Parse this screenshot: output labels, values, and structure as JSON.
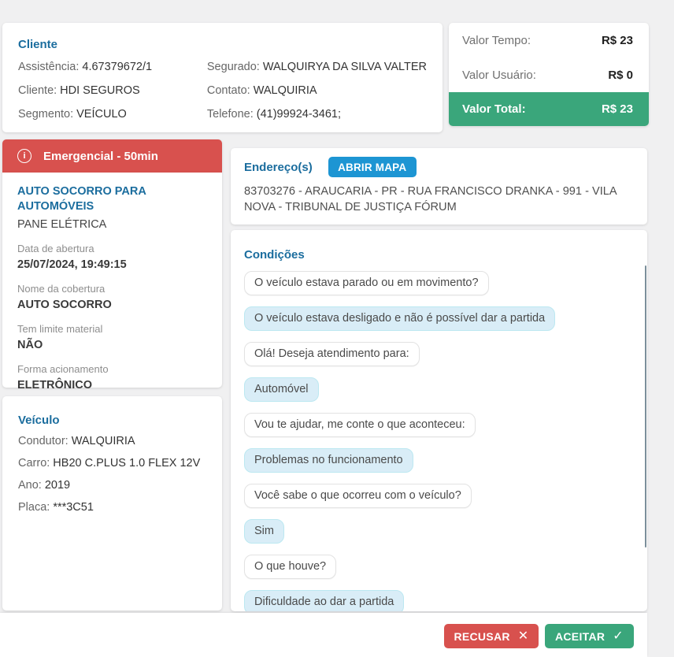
{
  "cliente": {
    "title": "Cliente",
    "col1": [
      {
        "label": "Assistência:",
        "value": "4.67379672/1"
      },
      {
        "label": "Cliente:",
        "value": "HDI SEGUROS"
      },
      {
        "label": "Segmento:",
        "value": "VEÍCULO"
      }
    ],
    "col2": [
      {
        "label": "Segurado:",
        "value": "WALQUIRYA DA SILVA VALTER"
      },
      {
        "label": "Contato:",
        "value": "WALQUIRIA"
      },
      {
        "label": "Telefone:",
        "value": "(41)99924-3461;"
      }
    ]
  },
  "valores": {
    "rows": [
      {
        "label": "Valor Tempo:",
        "value": "R$ 23"
      },
      {
        "label": "Valor Usuário:",
        "value": "R$ 0"
      }
    ],
    "total_label": "Valor Total:",
    "total_value": "R$ 23"
  },
  "servico": {
    "banner": "Emergencial - 50min",
    "info_icon": "i",
    "nome": "AUTO SOCORRO PARA AUTOMÓVEIS",
    "evento": "PANE ELÉTRICA",
    "detalhes": [
      {
        "label": "Data de abertura",
        "value": "25/07/2024, 19:49:15"
      },
      {
        "label": "Nome da cobertura",
        "value": "AUTO SOCORRO"
      },
      {
        "label": "Tem limite material",
        "value": "NÃO"
      },
      {
        "label": "Forma acionamento",
        "value": "ELETRÔNICO"
      }
    ]
  },
  "veiculo": {
    "title": "Veículo",
    "fields": [
      {
        "label": "Condutor:",
        "value": "WALQUIRIA"
      },
      {
        "label": "Carro:",
        "value": "HB20 C.PLUS 1.0 FLEX 12V"
      },
      {
        "label": "Ano:",
        "value": "2019"
      },
      {
        "label": "Placa:",
        "value": "***3C51"
      }
    ]
  },
  "endereco": {
    "title": "Endereço(s)",
    "map_button": "ABRIR MAPA",
    "address": "83703276 - ARAUCARIA - PR - RUA FRANCISCO DRANKA - 991 - VILA NOVA - TRIBUNAL DE JUSTIÇA FÓRUM"
  },
  "condicoes": {
    "title": "Condições",
    "messages": [
      {
        "type": "question",
        "text": "O veículo estava parado ou em movimento?"
      },
      {
        "type": "answer",
        "text": "O veículo estava desligado e não é possível dar a partida"
      },
      {
        "type": "question",
        "text": "Olá! Deseja atendimento para:"
      },
      {
        "type": "answer",
        "text": "Automóvel"
      },
      {
        "type": "question",
        "text": "Vou te ajudar, me conte o que aconteceu:"
      },
      {
        "type": "answer",
        "text": "Problemas no funcionamento"
      },
      {
        "type": "question",
        "text": "Você sabe o que ocorreu com o veículo?"
      },
      {
        "type": "answer",
        "text": "Sim"
      },
      {
        "type": "question",
        "text": "O que houve?"
      },
      {
        "type": "answer",
        "text": "Dificuldade ao dar a partida"
      }
    ]
  },
  "footer": {
    "recusar": "RECUSAR",
    "recusar_icon": "✕",
    "aceitar": "ACEITAR",
    "aceitar_icon": "✓"
  },
  "colors": {
    "title_blue": "#1b6d9e",
    "link_blue": "#1e9ad8",
    "map_button_blue": "#1d95d3",
    "danger_red": "#d8514e",
    "success_green": "#3aa67b",
    "bubble_blue": "#d9edf7",
    "page_bg": "#f0f0f1"
  }
}
